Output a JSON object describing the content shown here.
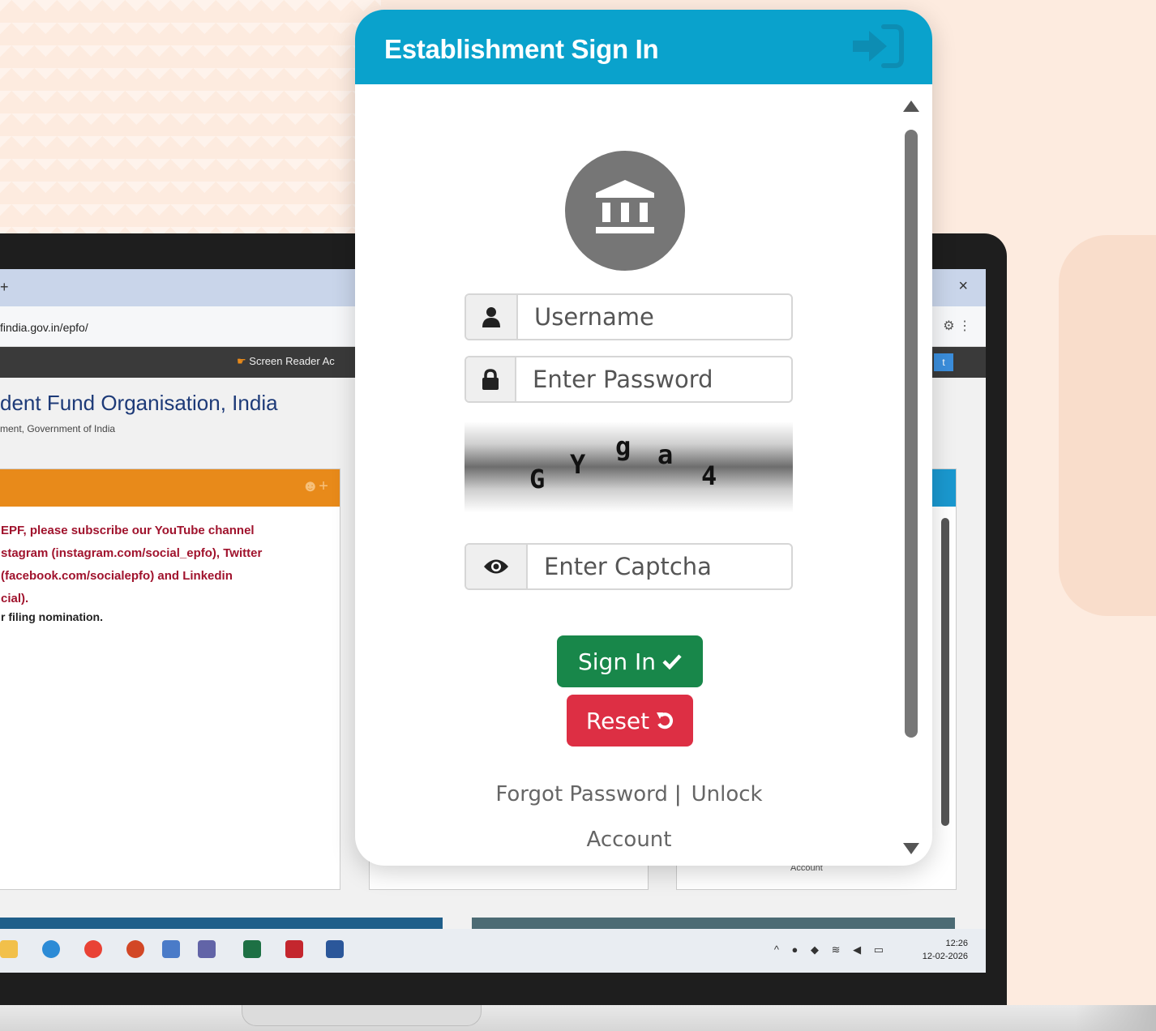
{
  "browser": {
    "new_tab": "+",
    "close": "×",
    "url": "findia.gov.in/epfo/",
    "screen_reader": "Screen Reader Ac",
    "org_title": "dent Fund Organisation, India",
    "org_subtitle": "ment, Government of India",
    "notice_lines": [
      "EPF, please subscribe our YouTube channel",
      "stagram (instagram.com/social_epfo), Twitter",
      "(facebook.com/socialepfo) and Linkedin",
      "cial)."
    ],
    "notice_filing": "r filing nomination.",
    "right_panel_text": "Account",
    "clock_time": "12:26",
    "clock_date": "12-02-2026"
  },
  "modal": {
    "title": "Establishment Sign In",
    "username_placeholder": "Username",
    "password_placeholder": "Enter Password",
    "captcha_chars": [
      "G",
      "Y",
      "g",
      "a",
      "4"
    ],
    "captcha_placeholder": "Enter Captcha",
    "signin_label": "Sign In",
    "reset_label": "Reset",
    "forgot_password": "Forgot Password",
    "separator": "|",
    "unlock_account_1": "Unlock",
    "unlock_account_2": "Account"
  },
  "colors": {
    "header": "#0aa2cc",
    "signin": "#18874a",
    "reset": "#dd2f44"
  }
}
